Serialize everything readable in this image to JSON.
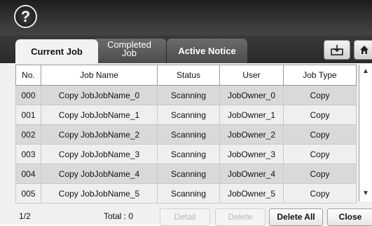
{
  "help": {
    "label": "?"
  },
  "tabs": [
    {
      "label": "Current Job"
    },
    {
      "label_line1": "Completed",
      "label_line2": "Job"
    },
    {
      "label": "Active Notice"
    }
  ],
  "toolbar": {
    "icons": [
      "download-tray-icon",
      "home-icon"
    ]
  },
  "table": {
    "columns": [
      "No.",
      "Job Name",
      "Status",
      "User",
      "Job Type"
    ],
    "rows": [
      [
        "000",
        "Copy JobJobName_0",
        "Scanning",
        "JobOwner_0",
        "Copy"
      ],
      [
        "001",
        "Copy JobJobName_1",
        "Scanning",
        "JobOwner_1",
        "Copy"
      ],
      [
        "002",
        "Copy JobJobName_2",
        "Scanning",
        "JobOwner_2",
        "Copy"
      ],
      [
        "003",
        "Copy JobJobName_3",
        "Scanning",
        "JobOwner_3",
        "Copy"
      ],
      [
        "004",
        "Copy JobJobName_4",
        "Scanning",
        "JobOwner_4",
        "Copy"
      ],
      [
        "005",
        "Copy JobJobName_5",
        "Scanning",
        "JobOwner_5",
        "Copy"
      ]
    ]
  },
  "footer": {
    "page": "1/2",
    "total": "Total : 0",
    "detail": "Detail",
    "delete": "Delete",
    "delete_all": "Delete All",
    "close": "Close"
  }
}
